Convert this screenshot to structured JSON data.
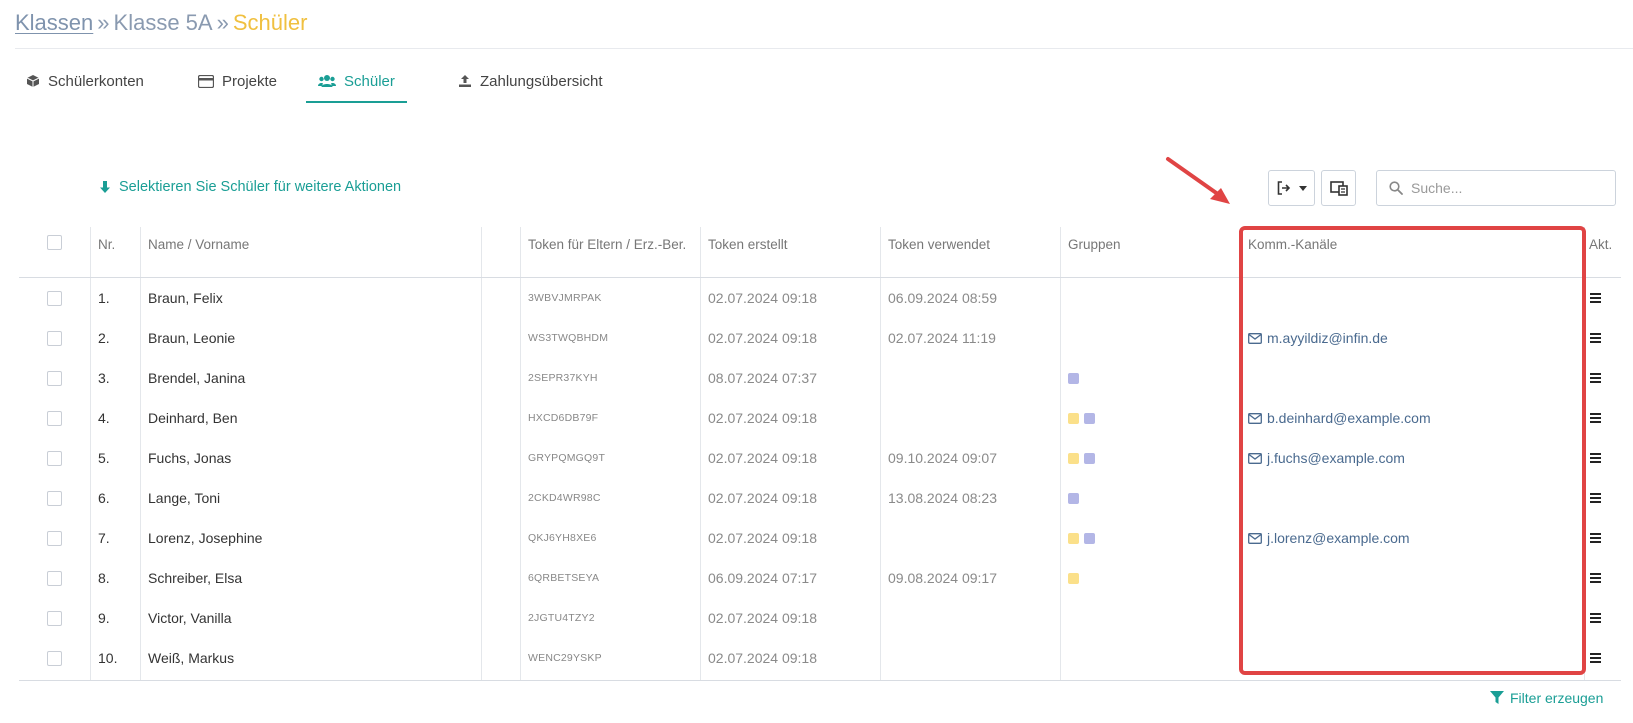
{
  "breadcrumb": {
    "classes": "Klassen",
    "class": "Klasse 5A",
    "current": "Schüler",
    "separator": "»"
  },
  "tabs": [
    {
      "label": "Schülerkonten",
      "icon": "cube-icon"
    },
    {
      "label": "Projekte",
      "icon": "card-icon"
    },
    {
      "label": "Schüler",
      "icon": "users-icon",
      "active": true
    },
    {
      "label": "Zahlungsübersicht",
      "icon": "upload-icon"
    }
  ],
  "toolbar": {
    "select_hint": "Selektieren Sie Schüler für weitere Aktionen",
    "search_placeholder": "Suche..."
  },
  "table": {
    "headers": {
      "nr": "Nr.",
      "name": "Name / Vorname",
      "token": "Token für Eltern / Erz.-Ber.",
      "created": "Token erstellt",
      "used": "Token verwendet",
      "groups": "Gruppen",
      "channels": "Komm.-Kanäle",
      "actions": "Akt."
    },
    "rows": [
      {
        "nr": "1.",
        "name": "Braun, Felix",
        "token": "3WBVJMRPAK",
        "created": "02.07.2024 09:18",
        "used": "06.09.2024 08:59",
        "groups": [],
        "email": ""
      },
      {
        "nr": "2.",
        "name": "Braun, Leonie",
        "token": "WS3TWQBHDM",
        "created": "02.07.2024 09:18",
        "used": "02.07.2024 11:19",
        "groups": [],
        "email": "m.ayyildiz@infin.de"
      },
      {
        "nr": "3.",
        "name": "Brendel, Janina",
        "token": "2SEPR37KYH",
        "created": "08.07.2024 07:37",
        "used": "",
        "groups": [
          "purple"
        ],
        "email": ""
      },
      {
        "nr": "4.",
        "name": "Deinhard, Ben",
        "token": "HXCD6DB79F",
        "created": "02.07.2024 09:18",
        "used": "",
        "groups": [
          "yellow",
          "purple"
        ],
        "email": "b.deinhard@example.com"
      },
      {
        "nr": "5.",
        "name": "Fuchs, Jonas",
        "token": "GRYPQMGQ9T",
        "created": "02.07.2024 09:18",
        "used": "09.10.2024 09:07",
        "groups": [
          "yellow",
          "purple"
        ],
        "email": "j.fuchs@example.com"
      },
      {
        "nr": "6.",
        "name": "Lange, Toni",
        "token": "2CKD4WR98C",
        "created": "02.07.2024 09:18",
        "used": "13.08.2024 08:23",
        "groups": [
          "purple"
        ],
        "email": ""
      },
      {
        "nr": "7.",
        "name": "Lorenz, Josephine",
        "token": "QKJ6YH8XE6",
        "created": "02.07.2024 09:18",
        "used": "",
        "groups": [
          "yellow",
          "purple"
        ],
        "email": "j.lorenz@example.com"
      },
      {
        "nr": "8.",
        "name": "Schreiber, Elsa",
        "token": "6QRBETSEYA",
        "created": "06.09.2024 07:17",
        "used": "09.08.2024 09:17",
        "groups": [
          "yellow"
        ],
        "email": ""
      },
      {
        "nr": "9.",
        "name": "Victor, Vanilla",
        "token": "2JGTU4TZY2",
        "created": "02.07.2024 09:18",
        "used": "",
        "groups": [],
        "email": ""
      },
      {
        "nr": "10.",
        "name": "Weiß, Markus",
        "token": "WENC29YSKP",
        "created": "02.07.2024 09:18",
        "used": "",
        "groups": [],
        "email": ""
      }
    ]
  },
  "footer": {
    "filter_label": "Filter erzeugen"
  },
  "colors": {
    "accent": "#1a9e95",
    "breadcrumb_current": "#f0c040",
    "group_yellow": "#fbe08a",
    "group_purple": "#b3b6e6",
    "highlight": "#e04444",
    "email": "#4a6a8f"
  }
}
